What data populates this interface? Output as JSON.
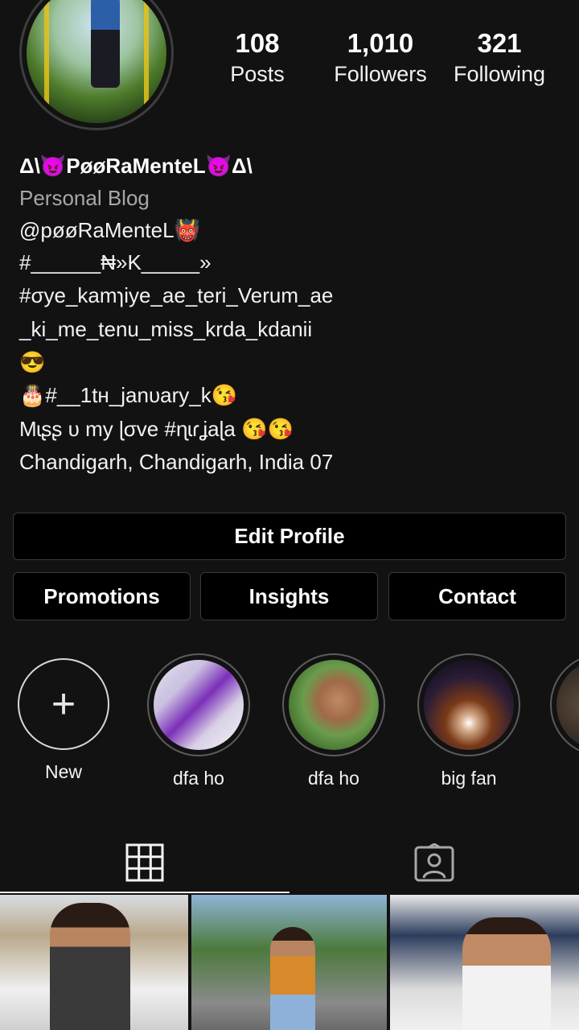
{
  "profile": {
    "stats": {
      "posts_count": "108",
      "posts_label": "Posts",
      "followers_count": "1,010",
      "followers_label": "Followers",
      "following_count": "321",
      "following_label": "Following"
    },
    "bio": {
      "display_name": "Δ\\😈PøøRaMenteL😈Δ\\",
      "category": "Personal Blog",
      "lines": [
        "@pøøRaMenteL👹",
        "#______₦»K_____»",
        "#σye_kamɿiye_ae_teri_Verum_ae",
        "_ki_me_tenu_miss_krda_kdanii",
        "😎",
        "🎂#__1tн_janυary_k😘",
        "Mɩʂʂ υ my ɭσve #ɳɩɾʝaɭa 😘😘",
        "Chandigarh, Chandigarh, India 07"
      ]
    }
  },
  "buttons": {
    "edit_profile": "Edit Profile",
    "promotions": "Promotions",
    "insights": "Insights",
    "contact": "Contact"
  },
  "highlights": [
    {
      "label": "New",
      "icon": "plus-icon"
    },
    {
      "label": "dfa ho"
    },
    {
      "label": "dfa ho"
    },
    {
      "label": "big fan"
    }
  ],
  "tabs": {
    "grid_icon": "grid-icon",
    "tagged_icon": "tagged-person-icon",
    "active": "grid"
  },
  "colors": {
    "background": "#121212",
    "button_bg": "#000000",
    "border": "#3a3a3a",
    "secondary_text": "#a8a8a8"
  }
}
